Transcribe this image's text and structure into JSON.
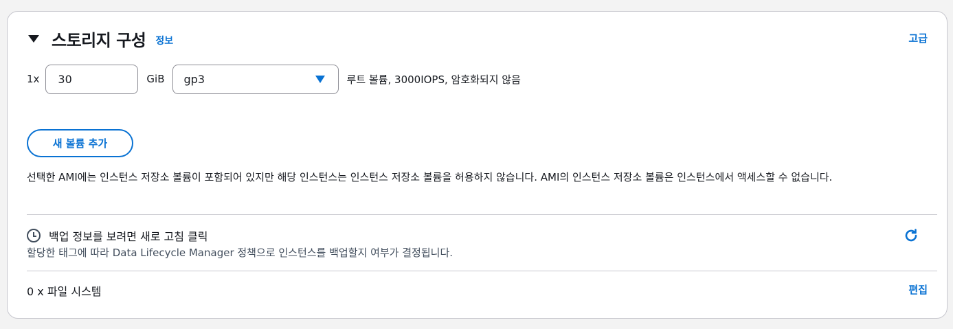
{
  "storage": {
    "title": "스토리지 구성",
    "info_link": "정보",
    "advanced_link": "고급",
    "volume": {
      "count_label": "1x",
      "size_value": "30",
      "unit": "GiB",
      "type_value": "gp3",
      "description": "루트 볼륨,  3000IOPS,  암호화되지 않음"
    },
    "add_volume_button": "새 볼륨 추가",
    "instance_store_notice": "선택한 AMI에는 인스턴스 저장소 볼륨이 포함되어 있지만 해당 인스턴스는 인스턴스 저장소 볼륨을 허용하지 않습니다. AMI의 인스턴스 저장소 볼륨은 인스턴스에서 액세스할 수 없습니다.",
    "backup": {
      "title": "백업 정보를 보려면 새로 고침 클릭",
      "subtitle": "할당한 태그에 따라 Data Lifecycle Manager 정책으로 인스턴스를 백업할지 여부가 결정됩니다."
    },
    "file_systems": {
      "label": "0 x 파일 시스템",
      "edit_link": "편집"
    }
  },
  "icons": {
    "collapse": "caret-down-icon",
    "select_caret": "chevron-down-icon",
    "clock": "clock-icon",
    "refresh": "refresh-icon"
  },
  "colors": {
    "accent": "#0972d3",
    "text": "#16191f",
    "secondary_text": "#414d5c",
    "border": "#c6c6cd"
  }
}
